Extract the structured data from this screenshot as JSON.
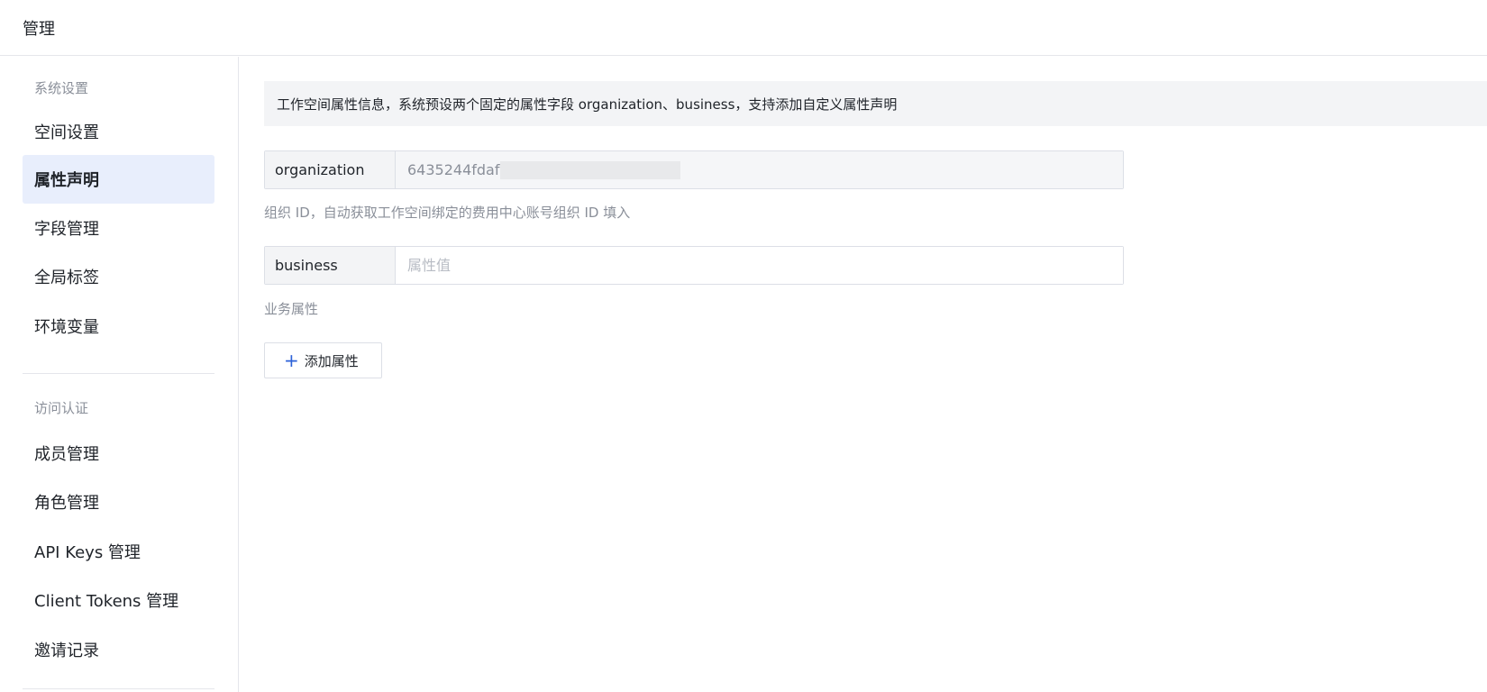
{
  "header": {
    "title": "管理"
  },
  "sidebar": {
    "groups": [
      {
        "title": "系统设置",
        "items": [
          {
            "label": "空间设置"
          },
          {
            "label": "属性声明"
          },
          {
            "label": "字段管理"
          },
          {
            "label": "全局标签"
          },
          {
            "label": "环境变量"
          }
        ]
      },
      {
        "title": "访问认证",
        "items": [
          {
            "label": "成员管理"
          },
          {
            "label": "角色管理"
          },
          {
            "label": "API Keys 管理"
          },
          {
            "label": "Client Tokens 管理"
          },
          {
            "label": "邀请记录"
          }
        ]
      }
    ],
    "active_item": "属性声明"
  },
  "main": {
    "info": "工作空间属性信息，系统预设两个固定的属性字段 organization、business，支持添加自定义属性声明",
    "properties": [
      {
        "key": "organization",
        "value": "6435244fdaf",
        "help": "组织 ID，自动获取工作空间绑定的费用中心账号组织 ID 填入"
      },
      {
        "key": "business",
        "value": "",
        "placeholder": "属性值",
        "help": "业务属性"
      }
    ],
    "add_button": {
      "label": "添加属性",
      "icon": "plus-icon"
    }
  },
  "colors": {
    "accent": "#2d62d8",
    "active_bg": "#e8eefc",
    "banner_bg": "#f3f4f6"
  }
}
